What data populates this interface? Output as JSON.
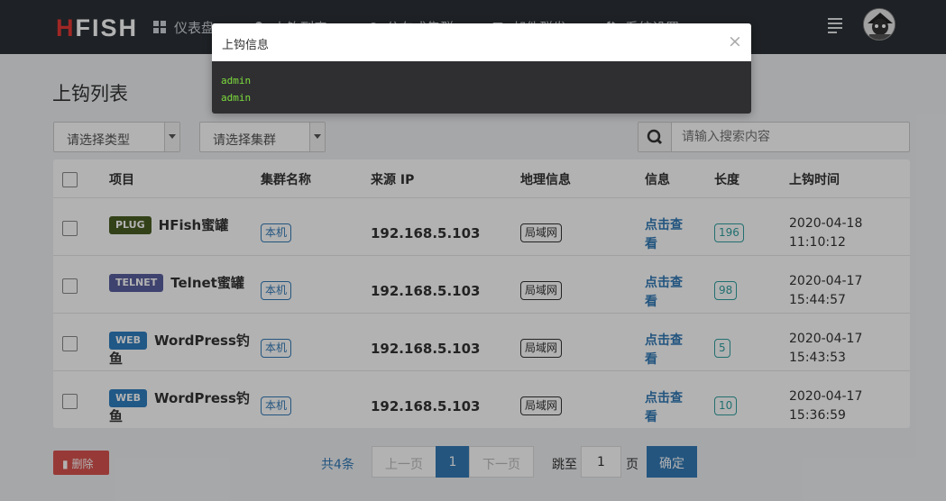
{
  "app": {
    "logo_h": "H",
    "logo_rest": "FISH"
  },
  "nav": [
    {
      "label": "仪表盘",
      "icon": "dashboard-icon"
    },
    {
      "label": "上钩列表",
      "icon": "fish-icon"
    },
    {
      "label": "分布式集群",
      "icon": "cloud-icon"
    },
    {
      "label": "邮件群发",
      "icon": "mail-icon"
    },
    {
      "label": "系统设置",
      "icon": "gear-icon"
    }
  ],
  "page": {
    "title": "上钩列表"
  },
  "filters": {
    "type_select": "请选择类型",
    "cluster_select": "请选择集群",
    "search_placeholder": "请输入搜索内容"
  },
  "table": {
    "headers": [
      "项目",
      "集群名称",
      "来源 IP",
      "地理信息",
      "信息",
      "长度",
      "上钩时间"
    ],
    "rows": [
      {
        "badge": "PLUG",
        "badge_color": "#4a5d23",
        "name": "HFish蜜罐",
        "cluster": "本机",
        "ip": "192.168.5.103",
        "geo": "局域网",
        "info": "点击查看",
        "length": "196",
        "date": "2020-04-18",
        "time": "11:10:12"
      },
      {
        "badge": "TELNET",
        "badge_color": "#5a5f9e",
        "name": "Telnet蜜罐",
        "cluster": "本机",
        "ip": "192.168.5.103",
        "geo": "局域网",
        "info": "点击查看",
        "length": "98",
        "date": "2020-04-17",
        "time": "15:44:57"
      },
      {
        "badge": "WEB",
        "badge_color": "#2f7fc1",
        "name": "WordPress钓鱼",
        "cluster": "本机",
        "ip": "192.168.5.103",
        "geo": "局域网",
        "info": "点击查看",
        "length": "5",
        "date": "2020-04-17",
        "time": "15:43:53"
      },
      {
        "badge": "WEB",
        "badge_color": "#2f7fc1",
        "name": "WordPress钓鱼",
        "cluster": "本机",
        "ip": "192.168.5.103",
        "geo": "局域网",
        "info": "点击查看",
        "length": "10",
        "date": "2020-04-17",
        "time": "15:36:59"
      }
    ]
  },
  "footer": {
    "delete_label": "删除",
    "total": "共4条",
    "prev": "上一页",
    "current_page": "1",
    "next": "下一页",
    "jump_to": "跳至",
    "jump_value": "1",
    "page_unit": "页",
    "confirm": "确定"
  },
  "modal": {
    "title": "上钩信息",
    "close": "×",
    "lines": [
      "admin",
      "admin"
    ]
  },
  "colors": {
    "topbar": "#2b3035",
    "accent": "#337ab7",
    "danger": "#d9534f",
    "console_text": "#7ddc3c"
  }
}
